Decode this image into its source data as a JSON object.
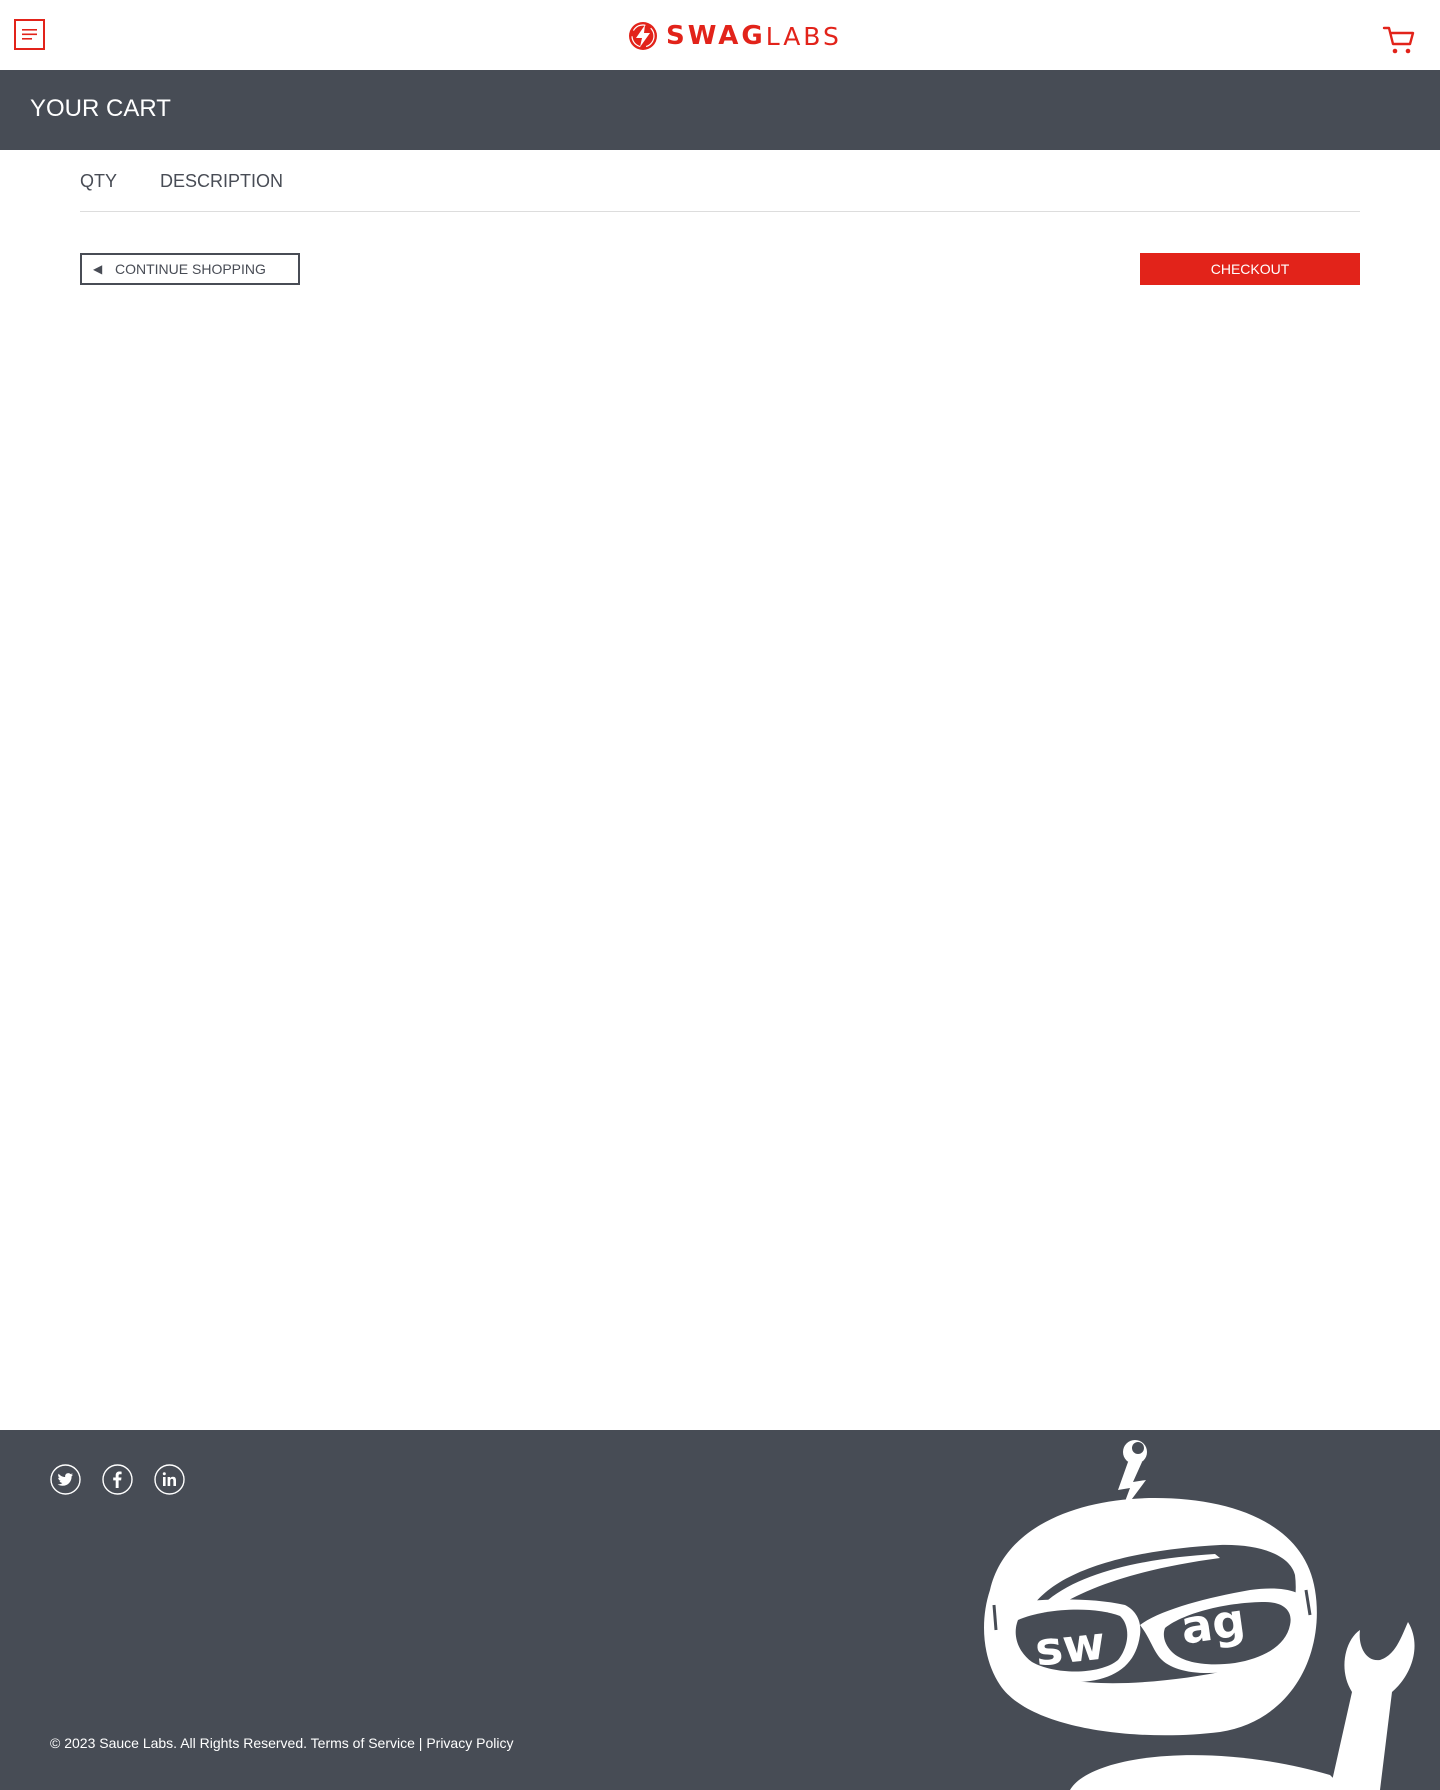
{
  "header": {
    "menu_icon": "hamburger-menu-icon",
    "logo_bold": "SWAG",
    "logo_light": "LABS",
    "cart_icon": "shopping-cart-icon"
  },
  "title_bar": {
    "title": "YOUR CART"
  },
  "cart": {
    "qty_header": "QTY",
    "description_header": "DESCRIPTION",
    "items": []
  },
  "actions": {
    "continue_arrow": "◀",
    "continue_label": "CONTINUE SHOPPING",
    "checkout_label": "CHECKOUT"
  },
  "footer": {
    "social": [
      "twitter-icon",
      "facebook-icon",
      "linkedin-icon"
    ],
    "copyright_text": "© 2023 Sauce Labs. All Rights Reserved. Terms of Service | Privacy Policy",
    "mascot_text": "swag"
  },
  "colors": {
    "brand_red": "#e2231a",
    "dark_gray": "#474c55",
    "text_gray": "#484c55"
  }
}
